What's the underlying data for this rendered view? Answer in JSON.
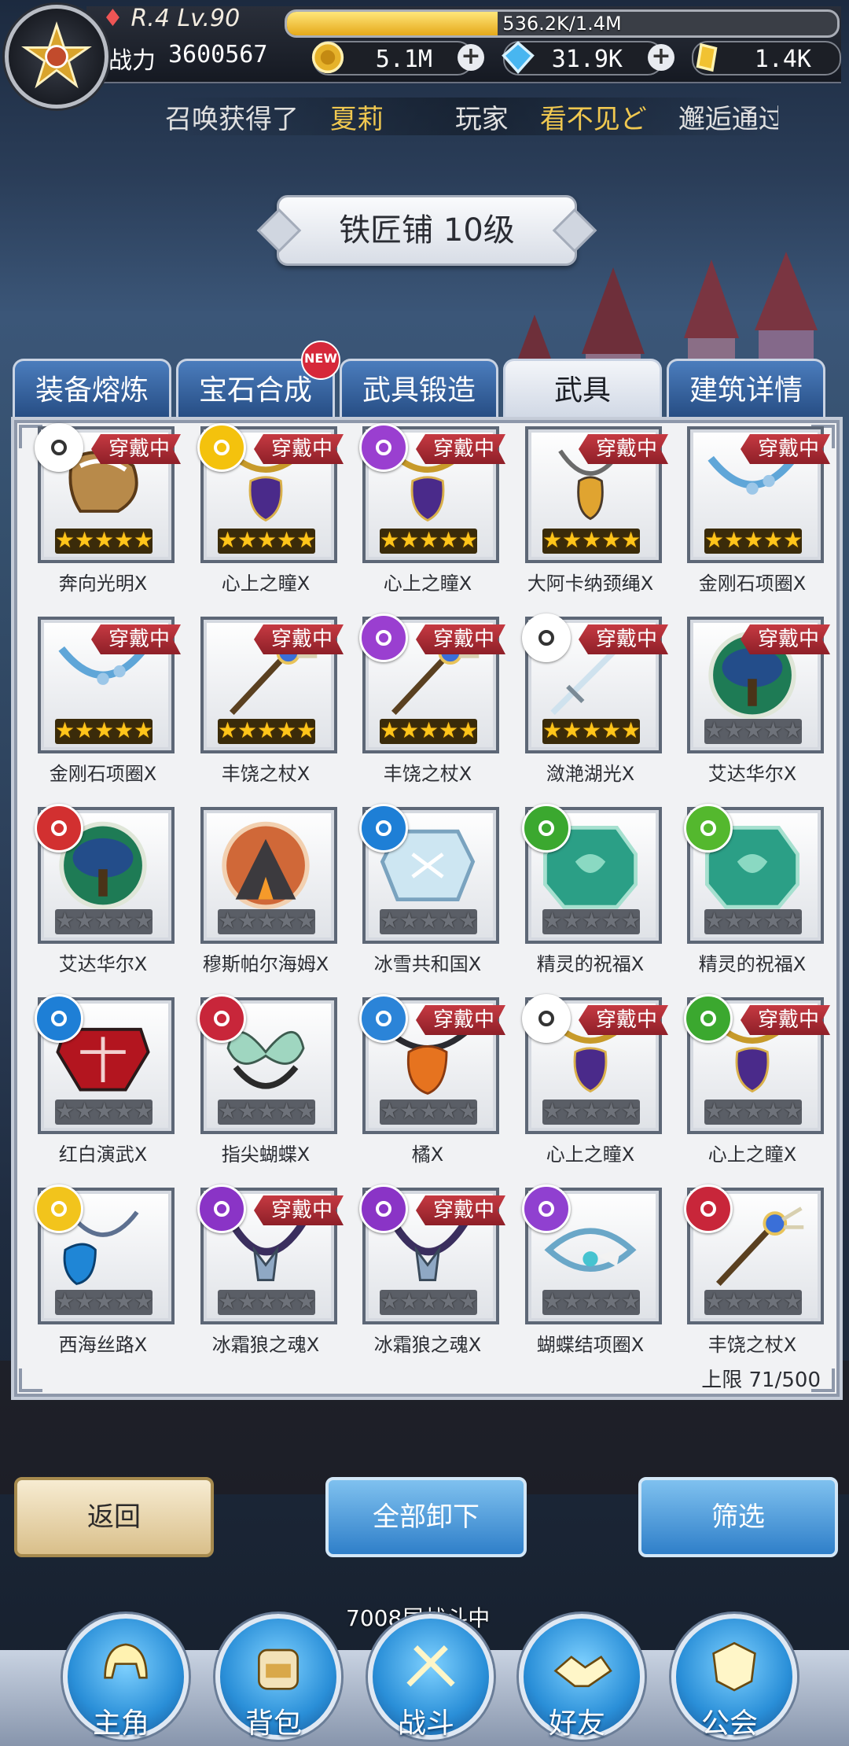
{
  "hud": {
    "rank": "R.4 Lv.90",
    "exp_text": "536.2K/1.4M",
    "exp_fraction": 0.383,
    "power_label": "战力",
    "power_value": "3600567",
    "gold": "5.1M",
    "diamond": "31.9K",
    "crystal": "1.4K"
  },
  "marquee": {
    "p1": "召唤获得了",
    "p1_name": "夏莉",
    "p2": "玩家",
    "p2_name": "看不见ど",
    "p3": "邂逅通过英雄"
  },
  "title": "铁匠铺 10级",
  "tabs": [
    {
      "label": "装备熔炼"
    },
    {
      "label": "宝石合成",
      "badge": "NEW"
    },
    {
      "label": "武具锻造"
    },
    {
      "label": "武具"
    },
    {
      "label": "建筑详情"
    }
  ],
  "worn_label": "穿戴中",
  "items": [
    {
      "name": "奔向光明X",
      "worn": true,
      "stars": 5,
      "rune": "sword",
      "art": "ring"
    },
    {
      "name": "心上之瞳X",
      "worn": true,
      "stars": 5,
      "rune": "yellow-flower",
      "art": "amulet-purple"
    },
    {
      "name": "心上之瞳X",
      "worn": true,
      "stars": 5,
      "rune": "purple-magnify",
      "art": "amulet-purple"
    },
    {
      "name": "大阿卡纳颈绳X",
      "worn": true,
      "stars": 5,
      "rune": "",
      "art": "amulet-gold"
    },
    {
      "name": "金刚石项圈X",
      "worn": true,
      "stars": 5,
      "rune": "",
      "art": "collar"
    },
    {
      "name": "金刚石项圈X",
      "worn": true,
      "stars": 5,
      "rune": "",
      "art": "collar"
    },
    {
      "name": "丰饶之杖X",
      "worn": true,
      "stars": 5,
      "rune": "",
      "art": "staff"
    },
    {
      "name": "丰饶之杖X",
      "worn": true,
      "stars": 5,
      "rune": "purple-moon",
      "art": "staff"
    },
    {
      "name": "潋滟湖光X",
      "worn": true,
      "stars": 5,
      "rune": "sword",
      "art": "sword"
    },
    {
      "name": "艾达华尔X",
      "worn": true,
      "stars": 0,
      "rune": "",
      "art": "tree"
    },
    {
      "name": "艾达华尔X",
      "worn": false,
      "stars": 0,
      "rune": "red-magnify",
      "art": "tree"
    },
    {
      "name": "穆斯帕尔海姆X",
      "worn": false,
      "stars": 0,
      "rune": "",
      "art": "volcano"
    },
    {
      "name": "冰雪共和国X",
      "worn": false,
      "stars": 0,
      "rune": "blue-circles",
      "art": "ice"
    },
    {
      "name": "精灵的祝福X",
      "worn": false,
      "stars": 0,
      "rune": "green-spiral",
      "art": "jade"
    },
    {
      "name": "精灵的祝福X",
      "worn": false,
      "stars": 0,
      "rune": "green-leaf",
      "art": "jade"
    },
    {
      "name": "红白演武X",
      "worn": false,
      "stars": 0,
      "rune": "blue-circles",
      "art": "redcrest"
    },
    {
      "name": "指尖蝴蝶X",
      "worn": false,
      "stars": 0,
      "rune": "red-triangle",
      "art": "butterfly"
    },
    {
      "name": "橘X",
      "worn": true,
      "stars": 0,
      "rune": "blue-wings",
      "art": "amulet-orange"
    },
    {
      "name": "心上之瞳X",
      "worn": true,
      "stars": 0,
      "rune": "sword",
      "art": "amulet-purple"
    },
    {
      "name": "心上之瞳X",
      "worn": true,
      "stars": 0,
      "rune": "green-spiral",
      "art": "amulet-purple"
    },
    {
      "name": "西海丝路X",
      "worn": false,
      "stars": 0,
      "rune": "yellow-scroll",
      "art": "amulet-blue"
    },
    {
      "name": "冰霜狼之魂X",
      "worn": true,
      "stars": 0,
      "rune": "purple-scroll",
      "art": "wolf"
    },
    {
      "name": "冰霜狼之魂X",
      "worn": true,
      "stars": 0,
      "rune": "purple-scroll",
      "art": "wolf"
    },
    {
      "name": "蝴蝶结项圈X",
      "worn": false,
      "stars": 0,
      "rune": "purple-wings",
      "art": "bow-collar"
    },
    {
      "name": "丰饶之杖X",
      "worn": false,
      "stars": 0,
      "rune": "red-triangle",
      "art": "staff"
    }
  ],
  "capacity": "上限 71/500",
  "buttons": {
    "back": "返回",
    "unequip_all": "全部卸下",
    "filter": "筛选"
  },
  "battle_status": "7008层战斗中",
  "nav": [
    {
      "label": "主角",
      "icon": "helmet-icon"
    },
    {
      "label": "背包",
      "icon": "backpack-icon"
    },
    {
      "label": "战斗",
      "icon": "crossed-swords-icon"
    },
    {
      "label": "好友",
      "icon": "handshake-icon"
    },
    {
      "label": "公会",
      "icon": "guild-crest-icon"
    }
  ],
  "colors": {
    "worn_badge": "#b32d36",
    "gold_star": "#ffc51a",
    "tab_blue": "#2f5f9e",
    "button_blue": "#3a8ad0",
    "button_back": "#e6d3a6"
  }
}
